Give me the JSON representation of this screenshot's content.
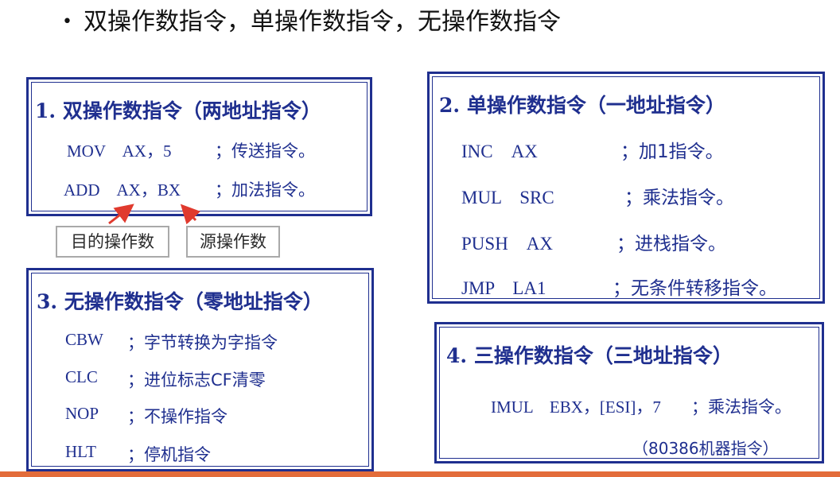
{
  "headline": "双操作数指令，单操作数指令，无操作数指令",
  "box1": {
    "title_num": "1.",
    "title": "双操作数指令（两地址指令）",
    "rows": [
      {
        "code": "MOV　AX，5",
        "comment": "；传送指令。"
      },
      {
        "code": "ADD　AX，BX",
        "comment": "；加法指令。"
      }
    ]
  },
  "labels": {
    "dest": "目的操作数",
    "src": "源操作数"
  },
  "box2": {
    "title_num": "2.",
    "title": "单操作数指令（一地址指令）",
    "rows": [
      {
        "code": "INC　AX",
        "comment": "；加1指令。"
      },
      {
        "code": "MUL　SRC",
        "comment": "；乘法指令。"
      },
      {
        "code": "PUSH　AX",
        "comment": "；进栈指令。"
      },
      {
        "code": "JMP　LA1",
        "comment": "；无条件转移指令。"
      }
    ]
  },
  "box3": {
    "title_num": "3.",
    "title": "无操作数指令（零地址指令）",
    "rows": [
      {
        "code": "CBW",
        "comment": "；字节转换为字指令"
      },
      {
        "code": "CLC",
        "comment": "；进位标志CF清零"
      },
      {
        "code": "NOP",
        "comment": "；不操作指令"
      },
      {
        "code": "HLT",
        "comment": "；停机指令"
      }
    ]
  },
  "box4": {
    "title_num": "4.",
    "title": "三操作数指令（三地址指令）",
    "row": {
      "code": "IMUL　EBX，[ESI]，7",
      "comment": "；乘法指令。"
    },
    "note": "（80386机器指令）"
  },
  "colors": {
    "box_border": "#1f2f8f",
    "text_blue": "#1f2f8f",
    "arrow_red": "#e03a2e",
    "bottom_rule": "#e36c3a",
    "tag_border": "#a9a9a9"
  }
}
